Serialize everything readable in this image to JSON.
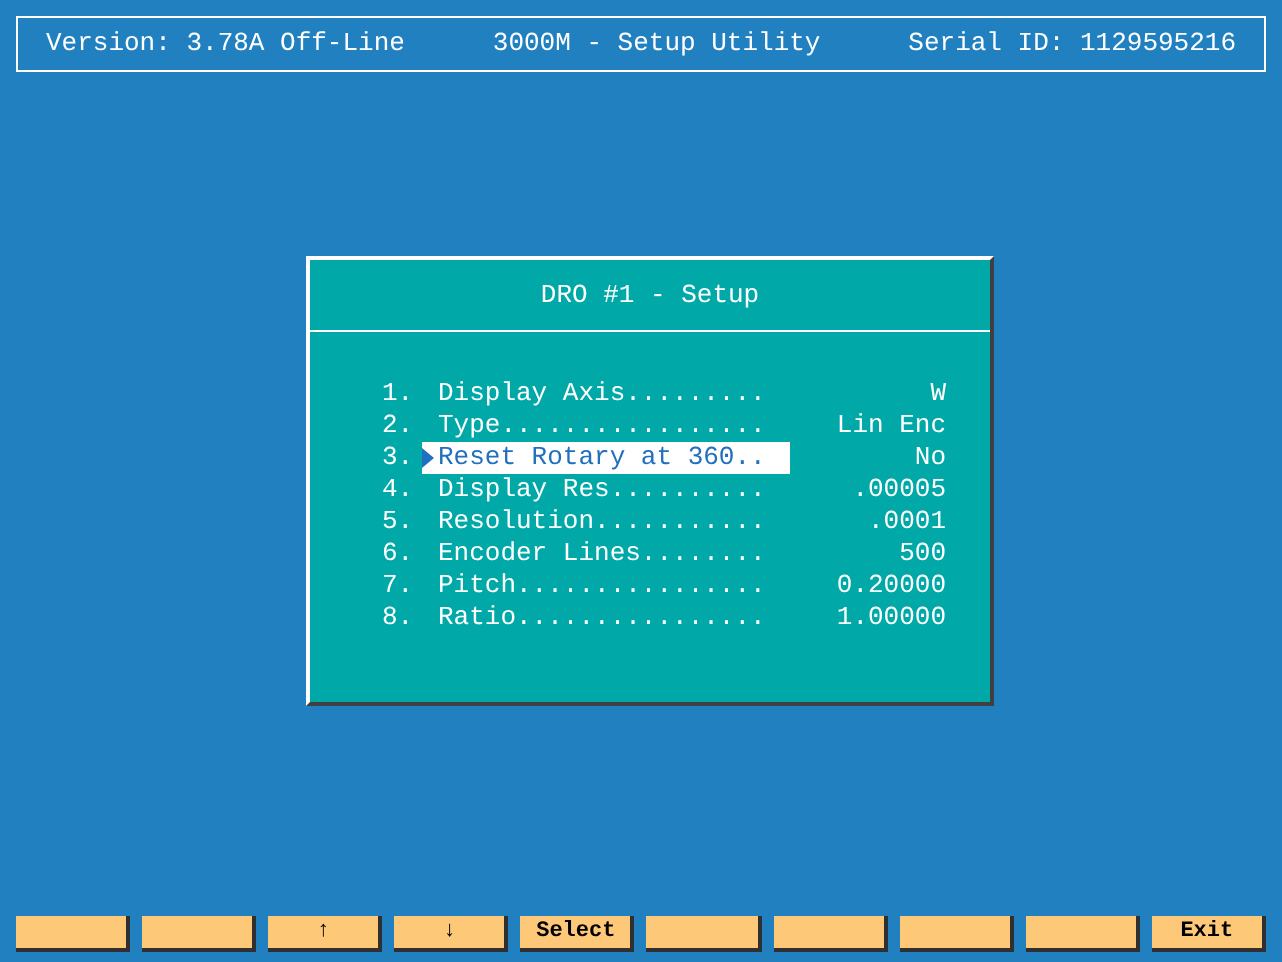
{
  "header": {
    "version": "Version: 3.78A Off-Line",
    "title": "3000M - Setup Utility",
    "serial": "Serial ID: 1129595216"
  },
  "dialog": {
    "title": "DRO #1 - Setup",
    "rows": [
      {
        "number": "1.",
        "label": "Display Axis.........",
        "value": "W",
        "selected": false
      },
      {
        "number": "2.",
        "label": "Type.................",
        "value": "Lin Enc",
        "selected": false
      },
      {
        "number": "3.",
        "label": "Reset Rotary at 360..",
        "value": "No",
        "selected": true
      },
      {
        "number": "4.",
        "label": "Display Res..........",
        "value": ".00005",
        "selected": false
      },
      {
        "number": "5.",
        "label": "Resolution...........",
        "value": ".0001",
        "selected": false
      },
      {
        "number": "6.",
        "label": "Encoder Lines........",
        "value": "500",
        "selected": false
      },
      {
        "number": "7.",
        "label": "Pitch................",
        "value": "0.20000",
        "selected": false
      },
      {
        "number": "8.",
        "label": "Ratio................",
        "value": "1.00000",
        "selected": false
      }
    ]
  },
  "function_keys": [
    {
      "kind": "blank"
    },
    {
      "kind": "blank"
    },
    {
      "kind": "labeled",
      "label": "↑"
    },
    {
      "kind": "labeled",
      "label": "↓"
    },
    {
      "kind": "labeled",
      "label": "Select"
    },
    {
      "kind": "blank"
    },
    {
      "kind": "blank"
    },
    {
      "kind": "blank"
    },
    {
      "kind": "blank"
    },
    {
      "kind": "labeled",
      "label": "Exit"
    }
  ]
}
